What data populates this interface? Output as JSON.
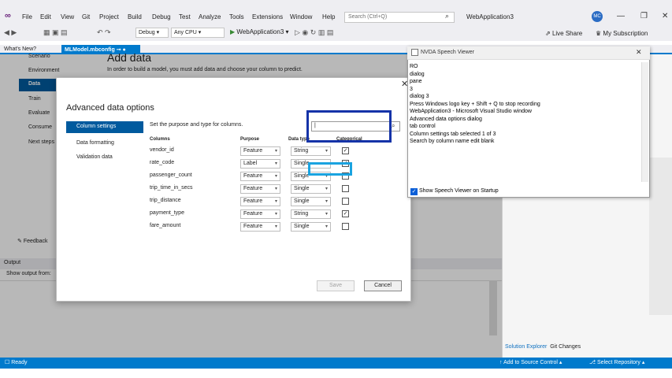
{
  "menu": {
    "items": [
      "File",
      "Edit",
      "View",
      "Git",
      "Project",
      "Build",
      "Debug",
      "Test",
      "Analyze",
      "Tools",
      "Extensions",
      "Window",
      "Help"
    ],
    "search_placeholder": "Search (Ctrl+Q)",
    "solution_name": "WebApplication3",
    "avatar_initials": "MC"
  },
  "toolbar": {
    "config": "Debug",
    "platform": "Any CPU",
    "run_label": "WebApplication3",
    "live_share": "Live Share",
    "subscription": "My Subscription"
  },
  "tabs": {
    "whats_new": "What's New?",
    "mlmodel": "MLModel.mbconfig"
  },
  "editor": {
    "title": "Add data",
    "description": "In order to build a model, you must add data and choose your column to predict.",
    "steps": [
      "Scenario",
      "Environment",
      "Data",
      "Train",
      "Evaluate",
      "Consume",
      "Next steps"
    ],
    "active_step": "Data",
    "feedback": "Feedback"
  },
  "dialog": {
    "title": "Advanced data options",
    "tabs": [
      "Column settings",
      "Data formatting",
      "Validation data"
    ],
    "description": "Set the purpose and type for columns.",
    "headers": {
      "columns": "Columns",
      "purpose": "Purpose",
      "data_type": "Data type",
      "categorical": "Categorical"
    },
    "rows": [
      {
        "name": "vendor_id",
        "purpose": "Feature",
        "type": "String",
        "categorical": true
      },
      {
        "name": "rate_code",
        "purpose": "Label",
        "type": "Single",
        "categorical": true
      },
      {
        "name": "passenger_count",
        "purpose": "Feature",
        "type": "Single",
        "categorical": false
      },
      {
        "name": "trip_time_in_secs",
        "purpose": "Feature",
        "type": "Single",
        "categorical": false
      },
      {
        "name": "trip_distance",
        "purpose": "Feature",
        "type": "Single",
        "categorical": false
      },
      {
        "name": "payment_type",
        "purpose": "Feature",
        "type": "String",
        "categorical": true
      },
      {
        "name": "fare_amount",
        "purpose": "Feature",
        "type": "Single",
        "categorical": false
      }
    ],
    "save": "Save",
    "cancel": "Cancel"
  },
  "output": {
    "title": "Output",
    "show_from": "Show output from:"
  },
  "solution_tabs": {
    "explorer": "Solution Explorer",
    "git": "Git Changes"
  },
  "status": {
    "ready": "Ready",
    "source_control": "Add to Source Control",
    "repository": "Select Repository"
  },
  "nvda": {
    "title": "NVDA Speech Viewer",
    "log": "RO\ndialog\npane\n3\ndialog  3\nPress Windows logo key + Shift + Q to stop recording\nWebApplication3 - Microsoft Visual Studio  window\nAdvanced data options  dialog\ntab control\nColumn settings  tab  selected  1 of 3\nSearch by column name  edit  blank",
    "startup_label": "Show Speech Viewer on Startup"
  }
}
